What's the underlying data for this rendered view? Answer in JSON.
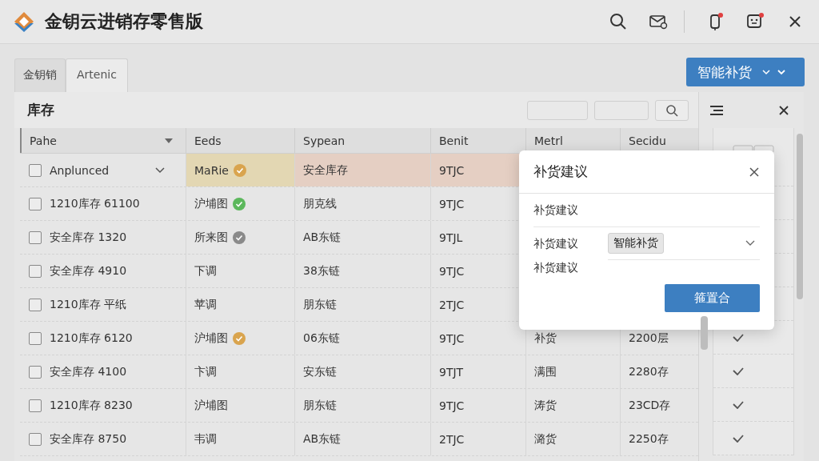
{
  "app": {
    "title": "金钥云进销存零售版"
  },
  "tabs": [
    {
      "label": "金钥销",
      "selected": false
    },
    {
      "label": "Artenic",
      "selected": true
    }
  ],
  "action_button": {
    "label": "智能补货"
  },
  "panel": {
    "title": "库存"
  },
  "table": {
    "columns": [
      "Pahe",
      "Eeds",
      "Sypean",
      "Benit",
      "Metrl",
      "Secidu"
    ],
    "rows": [
      {
        "checked": false,
        "expandable": true,
        "highlight": true,
        "cells": [
          "Anplunced",
          "MaRie",
          "安全库存",
          "9TJC"
        ],
        "status": {
          "color": "#d9a44e"
        }
      },
      {
        "checked": false,
        "expandable": false,
        "highlight": false,
        "cells": [
          "1210库存 61100",
          "沪埔图",
          "朋克线",
          "9TJC"
        ],
        "status": {
          "color": "#5cb85c"
        }
      },
      {
        "checked": false,
        "expandable": false,
        "highlight": false,
        "cells": [
          "安全库存 1320",
          "所来图",
          "AB东链",
          "9TJL"
        ],
        "status": {
          "color": "#8a8a8a"
        }
      },
      {
        "checked": false,
        "expandable": false,
        "highlight": false,
        "cells": [
          "安全库存 4910",
          "下调",
          "38东链",
          "9TJC"
        ]
      },
      {
        "checked": false,
        "expandable": false,
        "highlight": false,
        "cells": [
          "1210库存 平纸",
          "苹调",
          "朋东链",
          "2TJC"
        ]
      },
      {
        "checked": false,
        "expandable": false,
        "highlight": false,
        "cells": [
          "1210库存 6120",
          "沪埔图",
          "06东链",
          "9TJC",
          "补货",
          "2200层"
        ],
        "status": {
          "color": "#d9a44e"
        },
        "confirmed": true
      },
      {
        "checked": false,
        "expandable": false,
        "highlight": false,
        "cells": [
          "安全库存 4100",
          "卞调",
          "安东链",
          "9TJT",
          "满围",
          "2280存"
        ],
        "confirmed": true
      },
      {
        "checked": false,
        "expandable": false,
        "highlight": false,
        "cells": [
          "1210库存 8230",
          "沪埔图",
          "朋东链",
          "9TJC",
          "涛货",
          "23CD存"
        ],
        "confirmed": true
      },
      {
        "checked": false,
        "expandable": false,
        "highlight": false,
        "cells": [
          "安全库存 8750",
          "韦调",
          "AB东链",
          "2TJC",
          "潞货",
          "2250存"
        ],
        "confirmed": true
      }
    ]
  },
  "dialog": {
    "title": "补货建议",
    "fields": [
      {
        "kind": "text",
        "label": "补货建议"
      },
      {
        "kind": "select",
        "label": "补货建议",
        "value": "智能补货"
      },
      {
        "kind": "text",
        "label": "补货建议"
      }
    ],
    "button": "箍置合"
  }
}
